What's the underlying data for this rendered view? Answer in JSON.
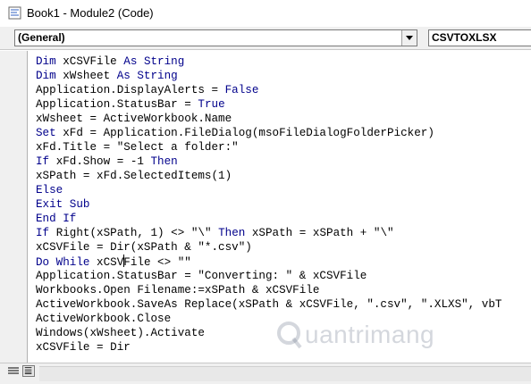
{
  "window": {
    "title": "Book1 - Module2 (Code)",
    "icon": "vba-module-icon"
  },
  "toolbar": {
    "object_combo": "(General)",
    "procedure_combo": "CSVTOXLSX"
  },
  "code": {
    "lines": [
      [
        {
          "t": "Dim ",
          "k": 1
        },
        {
          "t": "xCSVFile "
        },
        {
          "t": "As String",
          "k": 1
        }
      ],
      [
        {
          "t": "Dim ",
          "k": 1
        },
        {
          "t": "xWsheet "
        },
        {
          "t": "As String",
          "k": 1
        }
      ],
      [
        {
          "t": "Application.DisplayAlerts = "
        },
        {
          "t": "False",
          "k": 1
        }
      ],
      [
        {
          "t": "Application.StatusBar = "
        },
        {
          "t": "True",
          "k": 1
        }
      ],
      [
        {
          "t": "xWsheet = ActiveWorkbook.Name"
        }
      ],
      [
        {
          "t": "Set ",
          "k": 1
        },
        {
          "t": "xFd = Application.FileDialog(msoFileDialogFolderPicker)"
        }
      ],
      [
        {
          "t": "xFd.Title = \"Select a folder:\""
        }
      ],
      [
        {
          "t": "If ",
          "k": 1
        },
        {
          "t": "xFd.Show = -1 "
        },
        {
          "t": "Then",
          "k": 1
        }
      ],
      [
        {
          "t": "xSPath = xFd.SelectedItems(1)"
        }
      ],
      [
        {
          "t": "Else",
          "k": 1
        }
      ],
      [
        {
          "t": "Exit Sub",
          "k": 1
        }
      ],
      [
        {
          "t": "End If",
          "k": 1
        }
      ],
      [
        {
          "t": "If ",
          "k": 1
        },
        {
          "t": "Right(xSPath, 1) <> \"\\\" "
        },
        {
          "t": "Then ",
          "k": 1
        },
        {
          "t": "xSPath = xSPath + \"\\\""
        }
      ],
      [
        {
          "t": "xCSVFile = Dir(xSPath & \"*.csv\")"
        }
      ],
      [
        {
          "t": "Do While ",
          "k": 1
        },
        {
          "t": "xCSV"
        },
        {
          "t": "",
          "caret": 1
        },
        {
          "t": "File <> \"\""
        }
      ],
      [
        {
          "t": "Application.StatusBar = \"Converting: \" & xCSVFile"
        }
      ],
      [
        {
          "t": "Workbooks.Open Filename:=xSPath & xCSVFile"
        }
      ],
      [
        {
          "t": "ActiveWorkbook.SaveAs Replace(xSPath & xCSVFile, \".csv\", \".XLXS\", vbT"
        }
      ],
      [
        {
          "t": "ActiveWorkbook.Close"
        }
      ],
      [
        {
          "t": "Windows(xWsheet).Activate"
        }
      ],
      [
        {
          "t": "xCSVFile = Dir"
        }
      ]
    ],
    "keyword_color": "#00008b",
    "text_color": "#000000"
  },
  "watermark": {
    "text": "uantrimang",
    "logo": "q-logo-icon"
  },
  "statusbar": {
    "procedure_view": "procedure-view-icon",
    "full_module_view": "full-module-view-icon"
  }
}
